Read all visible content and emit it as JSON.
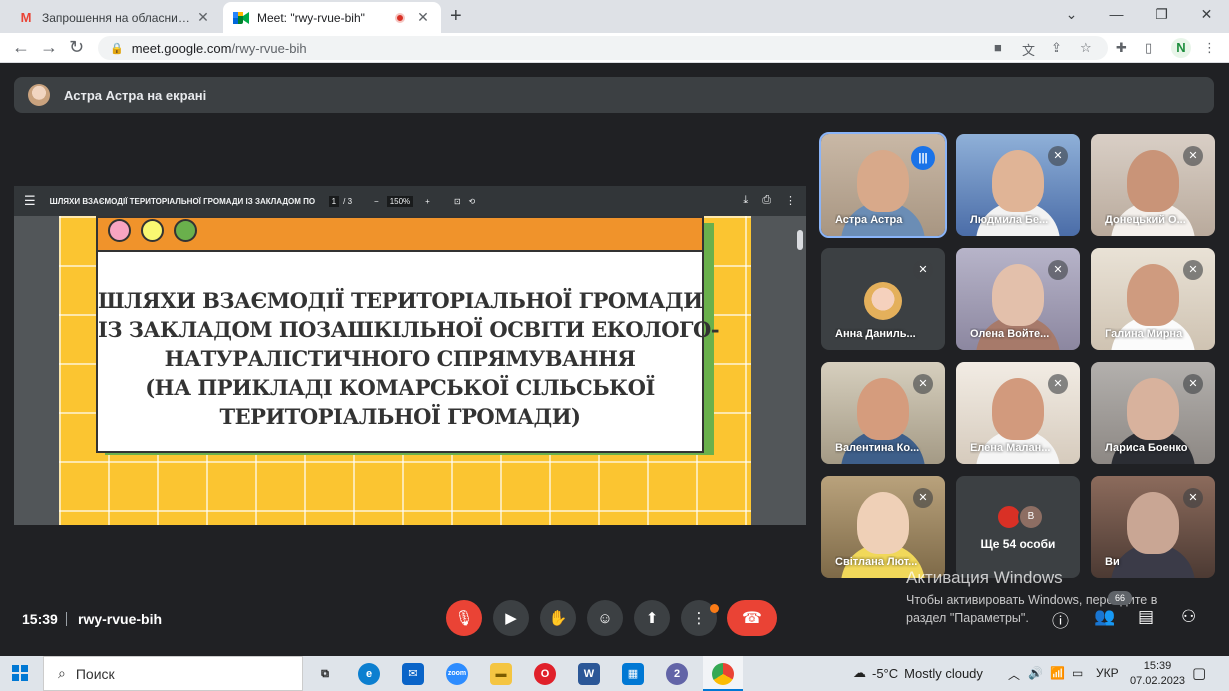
{
  "browser": {
    "tabs": [
      {
        "title": "Запрошення на обласний семі",
        "favicon": "gmail-icon"
      },
      {
        "title": "Meet: \"rwy-rvue-bih\"",
        "favicon": "meet-icon"
      }
    ],
    "url_host": "meet.google.com",
    "url_path": "/rwy-rvue-bih",
    "profile_initial": "N"
  },
  "meet": {
    "presenting_banner": "Астра Астра на екрані",
    "pdf": {
      "doc_title": "ШЛЯХИ ВЗАЄМОДІЇ ТЕРИТОРІАЛЬНОЇ ГРОМАДИ ІЗ ЗАКЛАДОМ ПО...",
      "page_current": "1",
      "page_sep": "/",
      "page_total": "3",
      "zoom": "150%"
    },
    "slide_title_lines": [
      "ШЛЯХИ ВЗАЄМОДІЇ ТЕРИТОРІАЛЬНОЇ ГРОМАДИ",
      "ІЗ ЗАКЛАДОМ ПОЗАШКІЛЬНОЇ ОСВІТИ ЕКОЛОГО-",
      "НАТУРАЛІСТИЧНОГО СПРЯМУВАННЯ",
      "(НА ПРИКЛАДІ КОМАРСЬКОЇ СІЛЬСЬКОЇ",
      "ТЕРИТОРІАЛЬНОЇ ГРОМАДИ)"
    ],
    "participants": [
      {
        "name": "Астра Астра",
        "speaking": true
      },
      {
        "name": "Людмила Бе..."
      },
      {
        "name": "Донецький О..."
      },
      {
        "name": "Анна Даниль..."
      },
      {
        "name": "Олена Войте..."
      },
      {
        "name": "Галина Мирна"
      },
      {
        "name": "Валентина Ко..."
      },
      {
        "name": "Елена Малан..."
      },
      {
        "name": "Лариса Боенко"
      },
      {
        "name": "Світлана Лют..."
      },
      {
        "name": "Ви"
      }
    ],
    "more_tile": {
      "label": "Ще 54 особи",
      "avatar_letter": "В"
    },
    "time": "15:39",
    "meeting_code": "rwy-rvue-bih",
    "people_count": "66"
  },
  "windows_watermark": {
    "title": "Активация Windows",
    "text": "Чтобы активировать Windows, перейдите в раздел \"Параметры\"."
  },
  "taskbar": {
    "search_placeholder": "Поиск",
    "temperature": "-5°C",
    "weather": "Mostly cloudy",
    "lang": "УКР",
    "time": "15:39",
    "date": "07.02.2023",
    "teams_badge": "2"
  },
  "colors": {
    "meet_bg": "#202124",
    "end_call": "#ea4335",
    "slide_yellow": "#fbc531",
    "slide_orange": "#f0932b",
    "slide_green": "#6ab04c"
  }
}
